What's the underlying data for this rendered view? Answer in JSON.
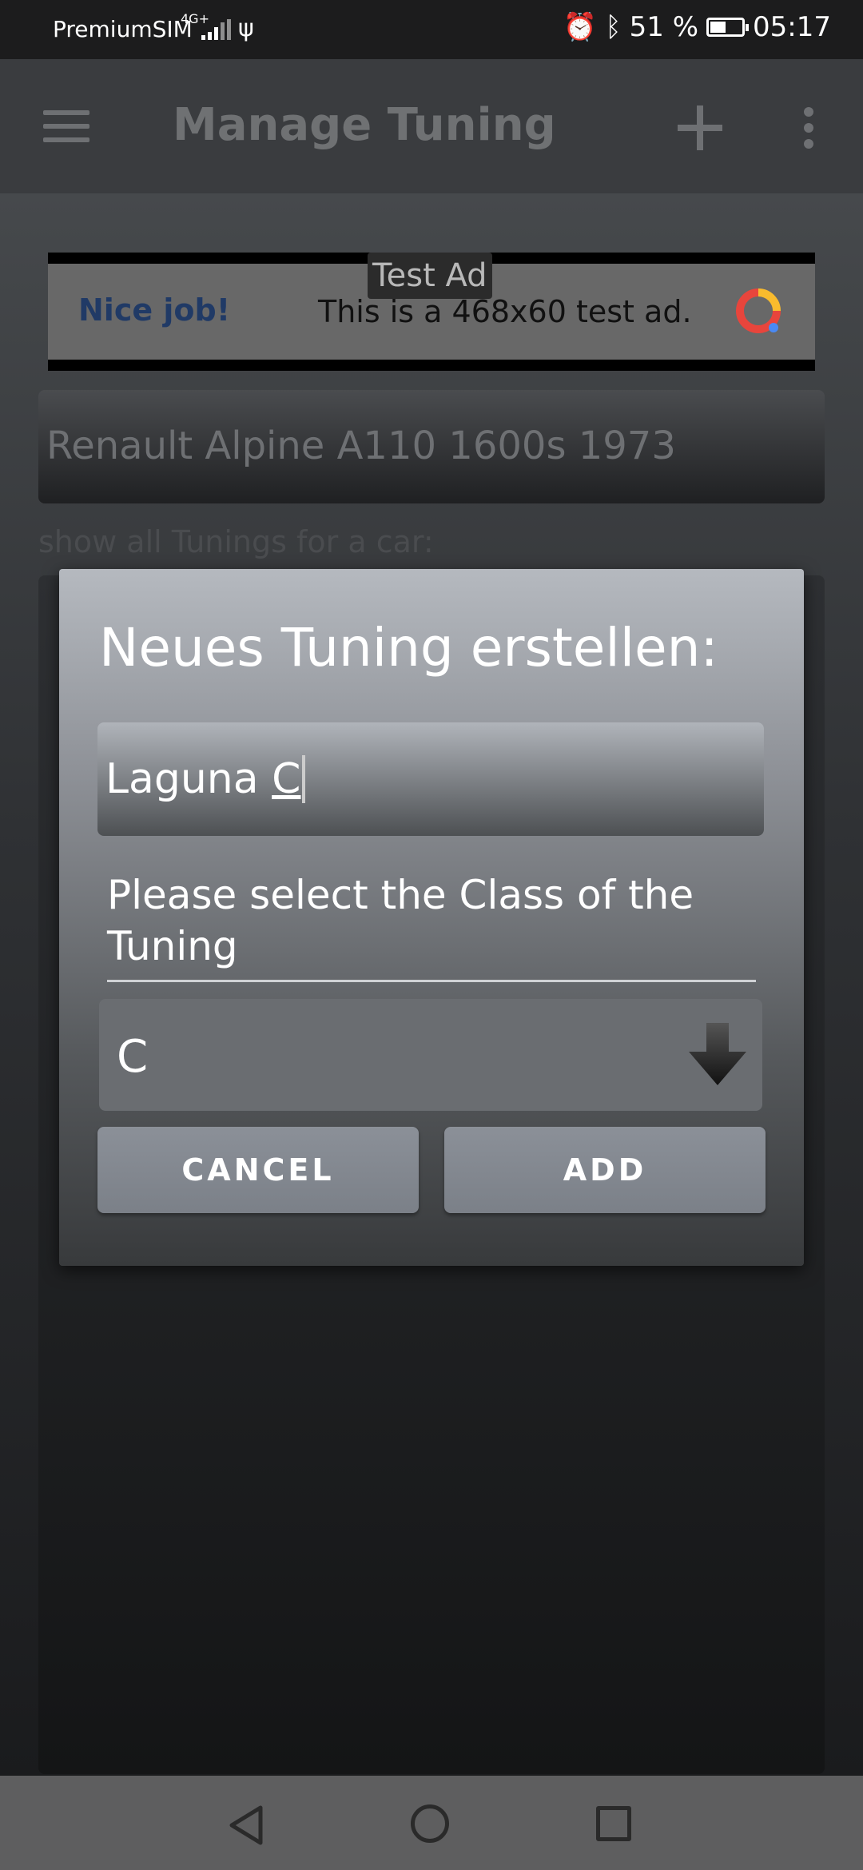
{
  "status_bar": {
    "carrier": "PremiumSIM",
    "network": "4G+",
    "battery": "51 %",
    "battery_level": 0.51,
    "time": "05:17"
  },
  "app_bar": {
    "title": "Manage Tuning",
    "icons": [
      "menu-icon",
      "plus-icon",
      "more-vert-icon"
    ]
  },
  "ad": {
    "label": "Test Ad",
    "headline": "Nice job!",
    "text": "This is a 468x60 test ad.",
    "icon": "ad-logo-icon"
  },
  "main": {
    "selected_car": "Renault Alpine A110 1600s 1973",
    "show_all_label": "show all Tunings for a car:"
  },
  "dialog": {
    "title": "Neues Tuning erstellen:",
    "name_value": "Laguna ",
    "name_underlined": "C",
    "class_label": "Please select the Class of the Tuning",
    "class_value": "C",
    "cancel_label": "CANCEL",
    "add_label": "ADD"
  },
  "nav_bar": {
    "icons": [
      "back-icon",
      "home-icon",
      "recent-apps-icon"
    ]
  }
}
